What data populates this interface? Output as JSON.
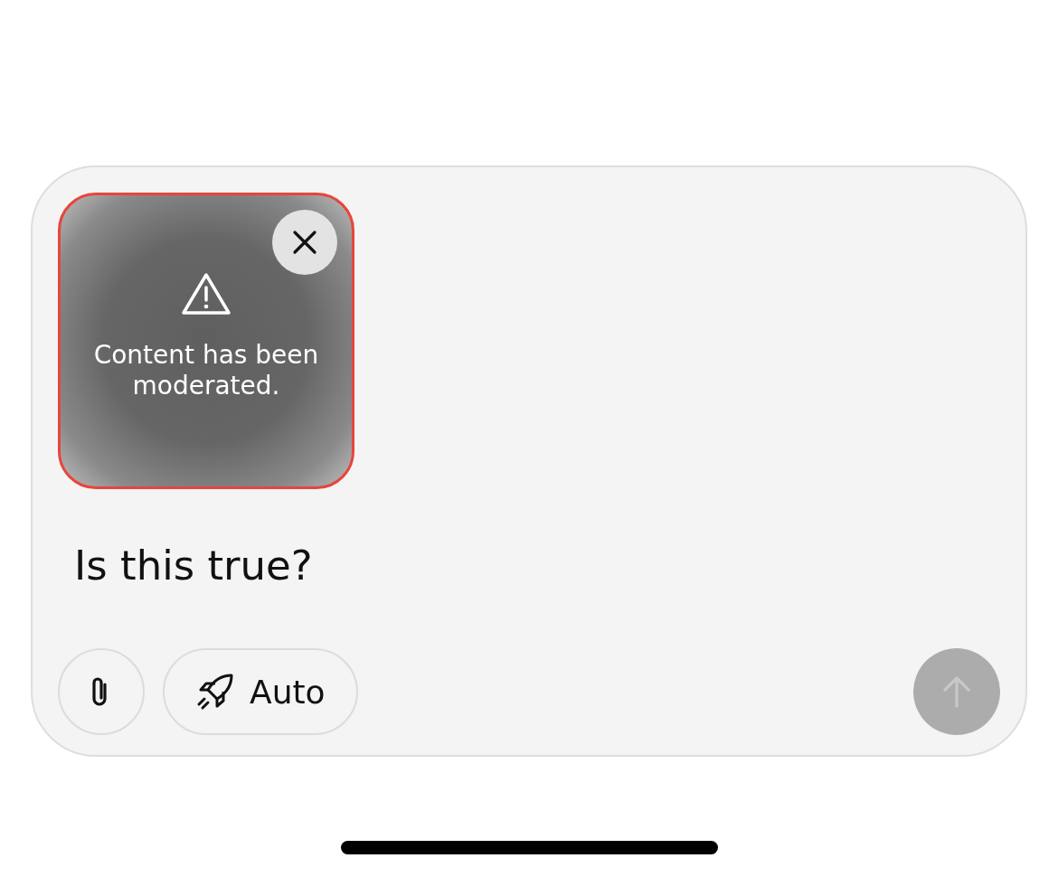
{
  "attachment": {
    "message": "Content has been moderated.",
    "moderated": true
  },
  "input": {
    "value": "Is this true?"
  },
  "mode_button": {
    "label": "Auto"
  },
  "send_button": {
    "disabled": true
  }
}
